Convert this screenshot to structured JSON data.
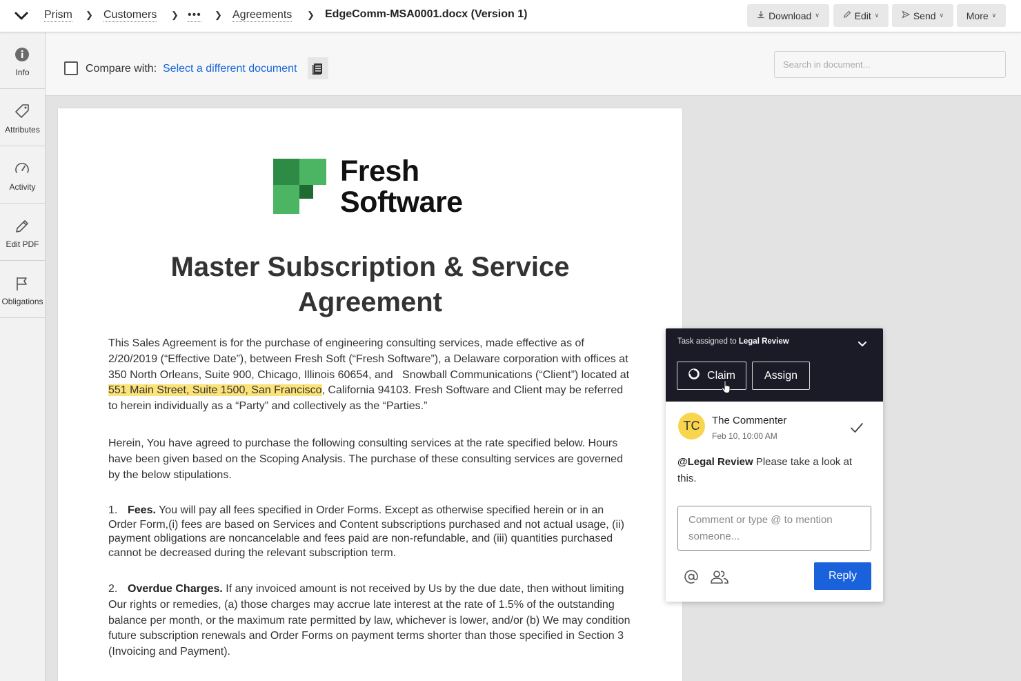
{
  "breadcrumb": {
    "items": [
      "Prism",
      "Customers",
      "•••",
      "Agreements"
    ],
    "current": "EdgeComm-MSA0001.docx (Version 1)"
  },
  "toolbar": {
    "download": "Download",
    "edit": "Edit",
    "send": "Send",
    "more": "More"
  },
  "sidebar": {
    "items": [
      {
        "label": "Info",
        "icon": "info-icon"
      },
      {
        "label": "Attributes",
        "icon": "tag-icon"
      },
      {
        "label": "Activity",
        "icon": "gauge-icon"
      },
      {
        "label": "Edit PDF",
        "icon": "pencil-icon"
      },
      {
        "label": "Obligations",
        "icon": "flag-icon"
      }
    ]
  },
  "compare": {
    "label": "Compare with:",
    "link": "Select a different document"
  },
  "search": {
    "placeholder": "Search in document..."
  },
  "document": {
    "logo_line1": "Fresh",
    "logo_line2": "Software",
    "title_line1": "Master Subscription & Service",
    "title_line2": "Agreement",
    "intro_before": "This Sales Agreement is for the purchase of engineering consulting services, made effective as of 2/20/2019 (“Effective Date”), between Fresh Soft (“Fresh Software”), a Delaware corporation with offices at 350 North Orleans, Suite 900, Chicago, Illinois 60654, and   Snowball Communications (“Client”) located at ",
    "intro_highlight": "551 Main Street, Suite 1500, San Francisco",
    "intro_after": ", California 94103. Fresh Software and Client may be referred to herein individually as a “Party” and collectively as the “Parties.”",
    "para2": "Herein, You have agreed to purchase the following consulting services at the rate specified below. Hours have been given based on the Scoping Analysis. The purchase of these consulting services are governed by the below stipulations.",
    "item1_num": "1.",
    "item1_title": "Fees.",
    "item1_text": " You will pay all fees specified in Order Forms. Except as otherwise specified herein or in an Order Form,(i) fees are based on Services and Content subscriptions purchased and not actual usage, (ii) payment obligations are noncancelable and fees paid are non-refundable, and (iii) quantities purchased cannot be decreased during the relevant subscription term.",
    "item2_num": "2.",
    "item2_title": "Overdue Charges.",
    "item2_text": " If any invoiced amount is not received by Us by the due date, then without limiting Our rights or remedies, (a) those charges may accrue late interest at the rate of 1.5% of the outstanding balance per month, or the maximum rate permitted by law, whichever is lower, and/or (b) We may condition future subscription renewals and Order Forms on payment terms shorter than those specified in Section 3 (Invoicing and Payment)."
  },
  "task": {
    "prefix": "Task assigned to ",
    "assignee": "Legal Review",
    "claim": "Claim",
    "assign": "Assign"
  },
  "comment": {
    "avatar": "TC",
    "author": "The Commenter",
    "time": "Feb 10, 10:00 AM",
    "mention": "@Legal Review",
    "text": " Please take a look at this.",
    "input_placeholder": "Comment or type @ to mention someone...",
    "reply": "Reply"
  },
  "colors": {
    "accent": "#1a62dc",
    "link": "#1565d8",
    "highlight": "#fbe37a",
    "panel_dark": "#1b1b27",
    "avatar": "#f8d54d",
    "logo_dark": "#2e8b45",
    "logo_light": "#4cb564",
    "logo_darkest": "#1f6a32"
  }
}
